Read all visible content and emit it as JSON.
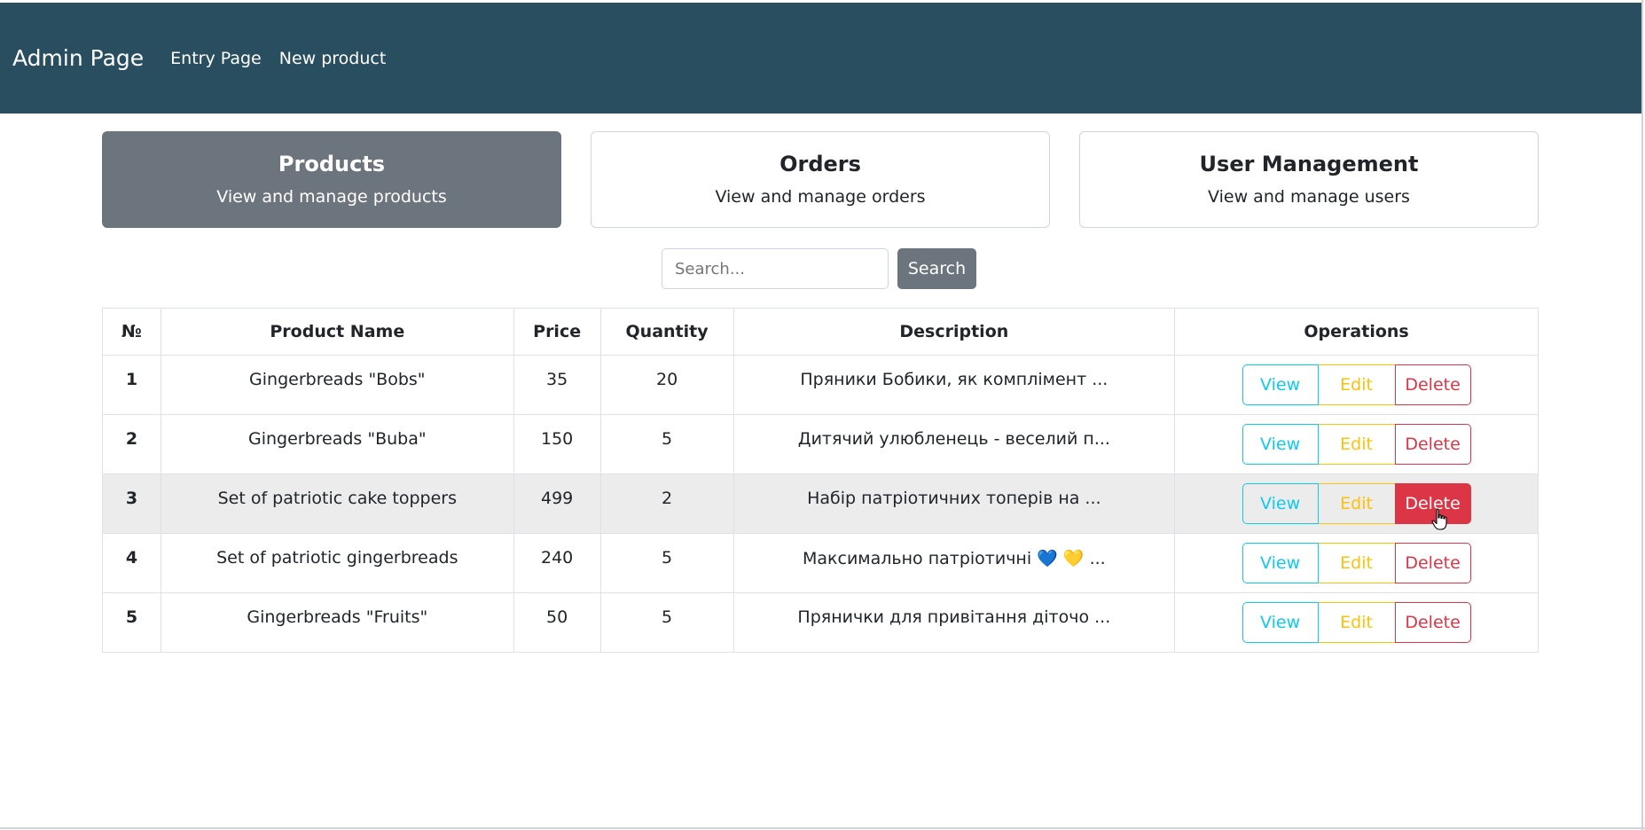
{
  "navbar": {
    "brand": "Admin Page",
    "links": [
      "Entry Page",
      "New product"
    ],
    "background": "#284e5f"
  },
  "cards": [
    {
      "title": "Products",
      "subtitle": "View and manage products",
      "active": true
    },
    {
      "title": "Orders",
      "subtitle": "View and manage orders",
      "active": false
    },
    {
      "title": "User Management",
      "subtitle": "View and manage users",
      "active": false
    }
  ],
  "search": {
    "placeholder": "Search...",
    "button_label": "Search"
  },
  "table": {
    "headers": [
      "№",
      "Product Name",
      "Price",
      "Quantity",
      "Description",
      "Operations"
    ],
    "rows": [
      {
        "num": "1",
        "name": "Gingerbreads \"Bobs\"",
        "price": "35",
        "quantity": "20",
        "description": "Пряники Бобики, як комплімент ..."
      },
      {
        "num": "2",
        "name": "Gingerbreads \"Buba\"",
        "price": "150",
        "quantity": "5",
        "description": "Дитячий улюбленець - веселий п..."
      },
      {
        "num": "3",
        "name": "Set of patriotic cake toppers",
        "price": "499",
        "quantity": "2",
        "description": "Набір патріотичних топерів на ..."
      },
      {
        "num": "4",
        "name": "Set of patriotic gingerbreads",
        "price": "240",
        "quantity": "5",
        "description": "Максимально патріотичні 💙 💛  ..."
      },
      {
        "num": "5",
        "name": "Gingerbreads \"Fruits\"",
        "price": "50",
        "quantity": "5",
        "description": "Прянички для привітання діточо ..."
      }
    ],
    "operations": {
      "view": "View",
      "edit": "Edit",
      "delete": "Delete"
    }
  },
  "colors": {
    "view": "#0dcaf0",
    "edit": "#ffc107",
    "delete": "#dc3545",
    "active_card": "#6c757d"
  },
  "cursor_icon": "hand-pointer-icon"
}
